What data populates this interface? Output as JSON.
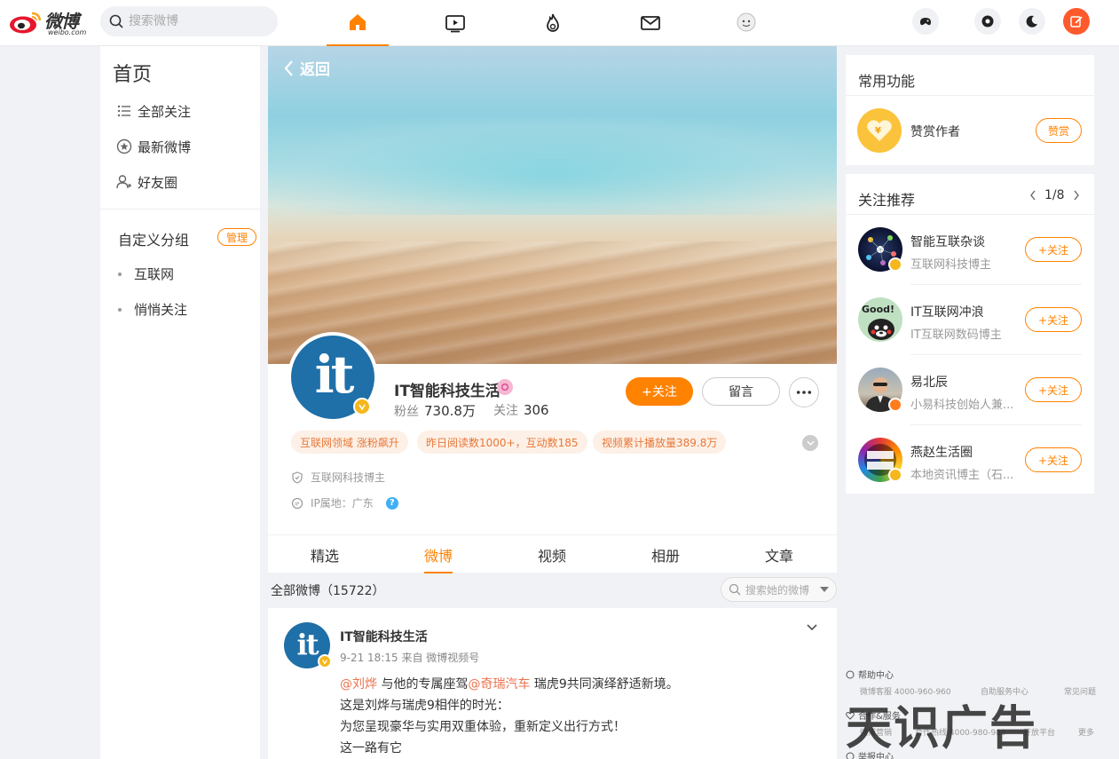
{
  "topbar": {
    "brand": "微博",
    "brand_sub": "weibo.com",
    "search_placeholder": "搜索微博",
    "nav_icons": [
      "home-icon",
      "video-icon",
      "hot-icon",
      "mail-icon",
      "avatar-icon"
    ],
    "right_icons": [
      "game-icon",
      "settings-icon",
      "dark-mode-icon",
      "compose-icon"
    ]
  },
  "leftbar": {
    "home": "首页",
    "items": [
      {
        "label": "全部关注",
        "icon": "list-icon"
      },
      {
        "label": "最新微博",
        "icon": "star-icon"
      },
      {
        "label": "好友圈",
        "icon": "friends-icon"
      }
    ],
    "group_title": "自定义分组",
    "manage": "管理",
    "groups": [
      "互联网",
      "悄悄关注"
    ]
  },
  "main": {
    "back": "返回",
    "profile": {
      "name": "IT智能科技生活",
      "fans_label": "粉丝",
      "fans": "730.8万",
      "follow_label": "关注",
      "follow": "306",
      "follow_btn": "+关注",
      "msg_btn": "留言",
      "more": "•••",
      "tags": [
        "互联网领域 涨粉飙升",
        "昨日阅读数1000+，互动数185",
        "视频累计播放量389.8万"
      ],
      "role": "互联网科技博主",
      "ip": "IP属地：广东",
      "help": "?"
    },
    "tabs": [
      "精选",
      "微博",
      "视频",
      "相册",
      "文章"
    ],
    "active_tab": "微博",
    "all_weibo": "全部微博（15722）",
    "weibo_search_placeholder": "搜索她的微博",
    "post": {
      "author": "IT智能科技生活",
      "meta": "9-21 18:15  来自 微博视频号",
      "mention1": "@刘烨",
      "line1_mid": " 与他的专属座驾",
      "mention2": "@奇瑞汽车",
      "line1_end": " 瑞虎9共同演绎舒适新境。",
      "line2": "这是刘烨与瑞虎9相伴的时光：",
      "line3": "为您呈现豪华与实用双重体验，重新定义出行方式！",
      "line4": "这一路有它"
    }
  },
  "right": {
    "common_title": "常用功能",
    "reward_text": "赞赏作者",
    "reward_btn": "赞赏",
    "rec_title": "关注推荐",
    "pager": "1/8",
    "recs": [
      {
        "name": "智能互联杂谈",
        "desc": "互联网科技博主",
        "btn": "+关注"
      },
      {
        "name": "IT互联网冲浪",
        "desc": "IT互联网数码博主",
        "btn": "+关注"
      },
      {
        "name": "易北辰",
        "desc": "小易科技创始人兼...",
        "btn": "+关注"
      },
      {
        "name": "燕赵生活圈",
        "desc": "本地资讯博主（石...",
        "btn": "+关注"
      }
    ]
  },
  "footer": {
    "help_center": "帮助中心",
    "help_links": [
      "微博客服 4000-960-960",
      "自助服务中心",
      "常见问题"
    ],
    "coop": "合作&服务",
    "coop_links": [
      "微博营销",
      "合作热线 4000-980-980",
      "开放平台",
      "更多"
    ],
    "report": "举报中心",
    "watermark": "天识广告"
  },
  "colors": {
    "accent": "#ff8200",
    "link": "#eb7350",
    "verified": "#f5b71c"
  }
}
